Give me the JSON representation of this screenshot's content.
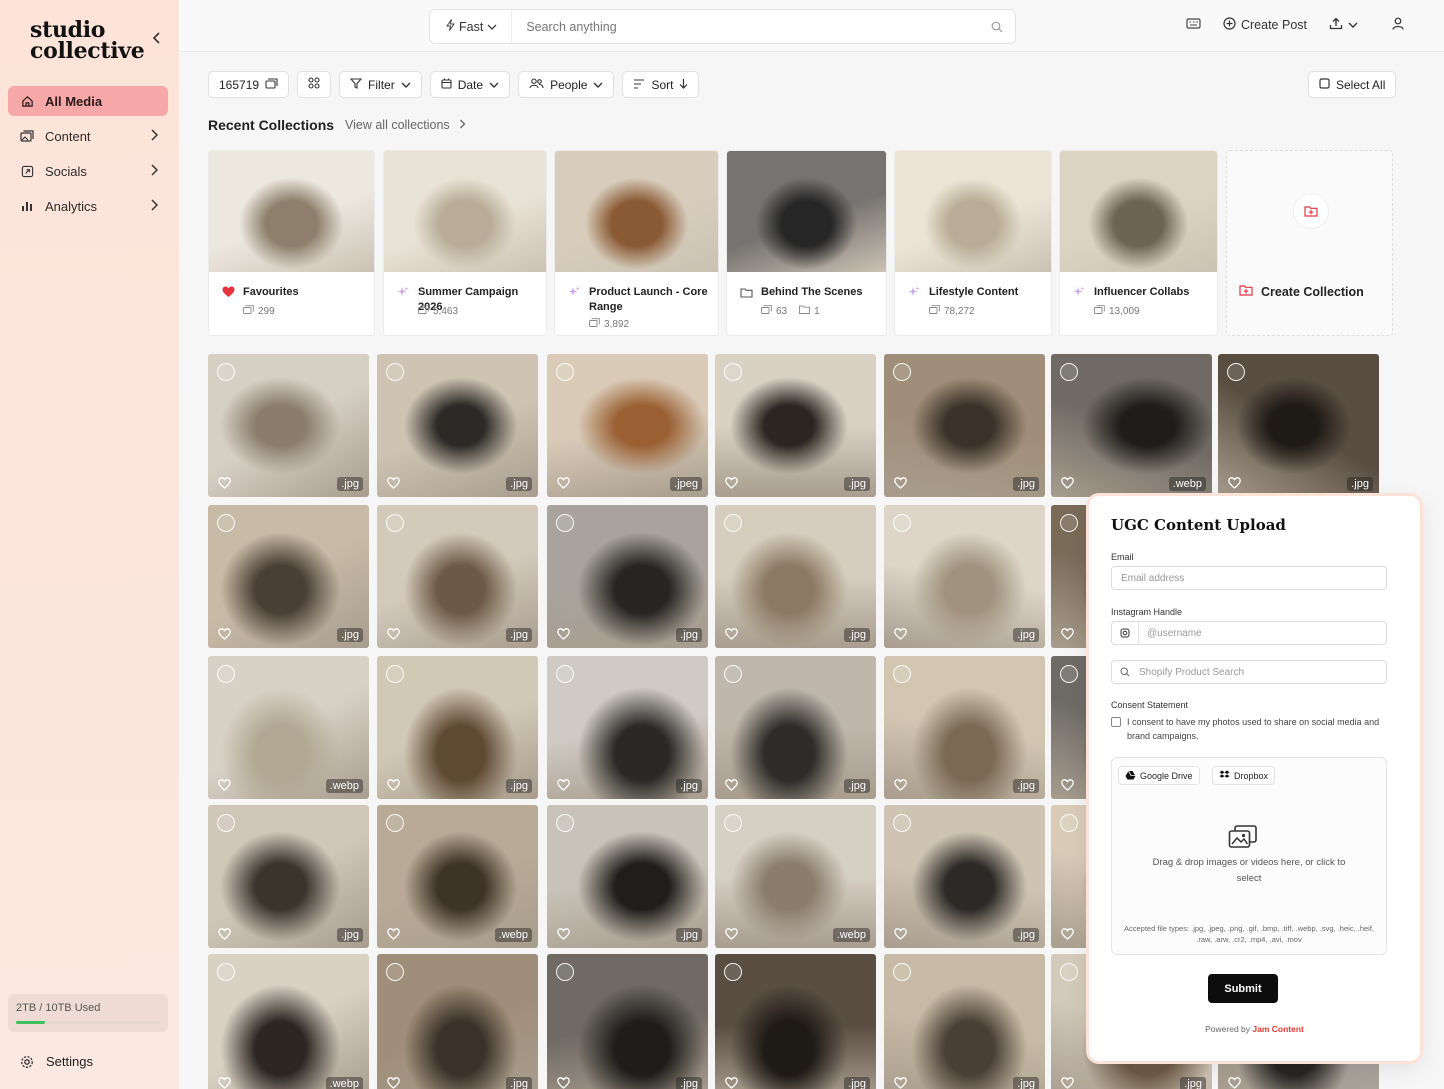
{
  "app": {
    "logo_line1": "studio",
    "logo_line2": "collective"
  },
  "sidebar": {
    "items": [
      {
        "label": "All Media",
        "active": true
      },
      {
        "label": "Content"
      },
      {
        "label": "Socials"
      },
      {
        "label": "Analytics"
      }
    ],
    "storage": {
      "label": "2TB / 10TB Used",
      "used_fraction": 0.2
    },
    "settings_label": "Settings"
  },
  "topbar": {
    "search_mode": "Fast",
    "search_placeholder": "Search anything",
    "create_post": "Create Post"
  },
  "toolbar": {
    "count": "165719",
    "filter": "Filter",
    "date": "Date",
    "people": "People",
    "sort": "Sort",
    "select_all": "Select All"
  },
  "collections": {
    "title": "Recent Collections",
    "view_all": "View all collections",
    "items": [
      {
        "name": "Favourites",
        "count": "299",
        "icon": "heart-icon"
      },
      {
        "name": "Summer Campaign 2026",
        "count": "5,463",
        "icon": "sparkle-icon"
      },
      {
        "name": "Product Launch - Core Range",
        "count": "3,892",
        "icon": "sparkle-icon"
      },
      {
        "name": "Behind The Scenes",
        "count": "63",
        "folders": "1",
        "icon": "folder-icon"
      },
      {
        "name": "Lifestyle Content",
        "count": "78,272",
        "icon": "sparkle-icon"
      },
      {
        "name": "Influencer Collabs",
        "count": "13,009",
        "icon": "sparkle-icon"
      }
    ],
    "create_label": "Create Collection"
  },
  "media": {
    "rows": [
      [
        ".jpg",
        ".jpg",
        ".jpeg",
        ".jpg",
        ".jpg",
        ".webp",
        ".jpg"
      ],
      [
        ".jpg",
        ".jpg",
        ".jpg",
        ".jpg",
        ".jpg",
        "",
        ""
      ],
      [
        ".webp",
        ".jpg",
        ".jpg",
        ".jpg",
        ".jpg",
        "",
        ""
      ],
      [
        ".jpg",
        ".webp",
        ".jpg",
        ".webp",
        ".jpg",
        "",
        ""
      ],
      [
        ".webp",
        ".jpg",
        ".jpg",
        ".jpg",
        ".jpg",
        ".jpg",
        ""
      ]
    ]
  },
  "upload": {
    "title": "UGC Content Upload",
    "email_label": "Email",
    "email_placeholder": "Email address",
    "ig_label": "Instagram Handle",
    "ig_placeholder": "@username",
    "shopify_placeholder": "Shopify Product Search",
    "consent_label": "Consent Statement",
    "consent_text": "I consent to have my photos used to share on social media and brand campaigns.",
    "google_drive": "Google Drive",
    "dropbox": "Dropbox",
    "drop_text": "Drag & drop images or videos here, or click to select",
    "accepted": "Accepted file types: .jpg, .jpeg, .png, .gif, .bmp, .tiff, .webp, .svg, .heic, .heif, .raw, .arw, .cr2, .mp4, .avi, .mov",
    "submit": "Submit",
    "powered_prefix": "Powered by",
    "powered_brand": "Jam Content"
  }
}
